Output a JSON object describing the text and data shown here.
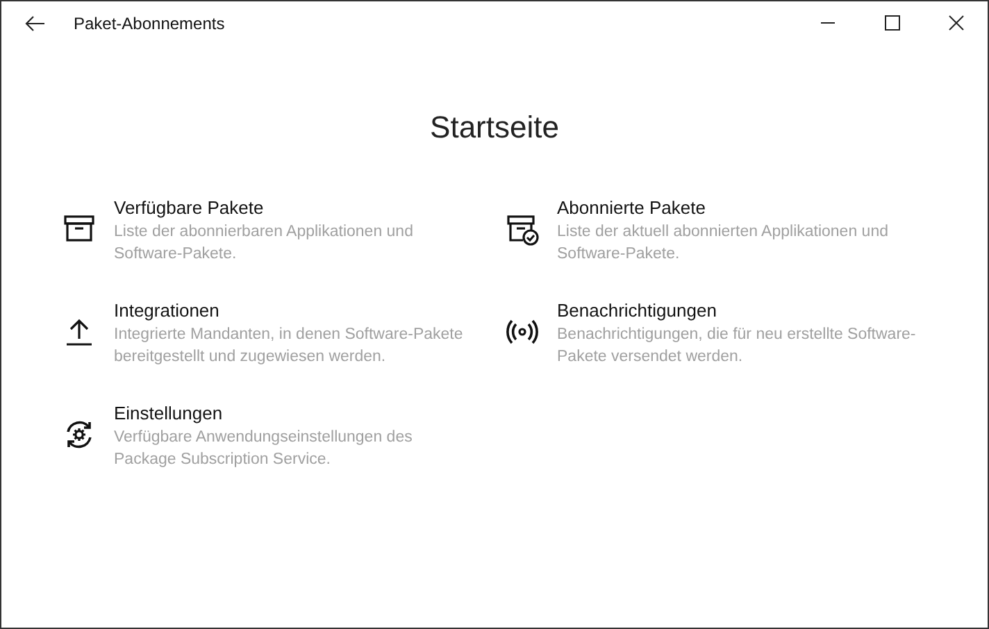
{
  "window": {
    "title": "Paket-Abonnements"
  },
  "heading": "Startseite",
  "items": [
    {
      "title": "Verfügbare Pakete",
      "description": "Liste der abonnierbaren Applikationen und Software-Pakete."
    },
    {
      "title": "Abonnierte Pakete",
      "description": "Liste der aktuell abonnierten Applikationen und Software-Pakete."
    },
    {
      "title": "Integrationen",
      "description": "Integrierte Mandanten, in denen Software-Pakete bereitgestellt und zugewiesen werden."
    },
    {
      "title": "Benachrichtigungen",
      "description": "Benachrichtigungen, die für neu erstellte Software-Pakete versendet werden."
    },
    {
      "title": "Einstellungen",
      "description": "Verfügbare Anwendungseinstellungen des Package Subscription Service."
    }
  ]
}
